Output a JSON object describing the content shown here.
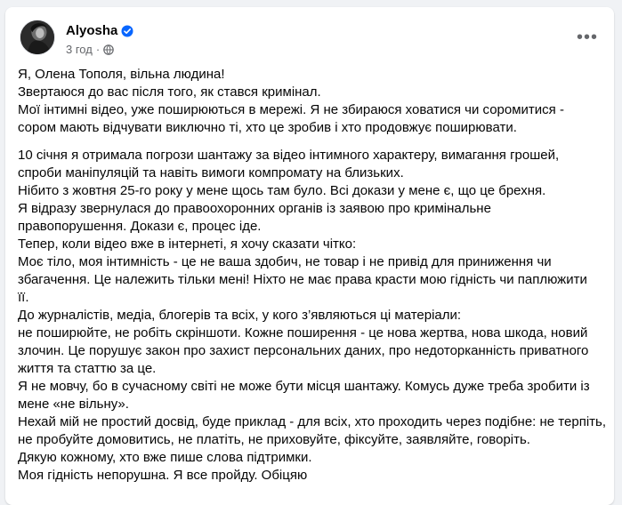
{
  "post": {
    "author": "Alyosha",
    "time": "3 год",
    "meta_separator": "·",
    "more_label": "•••",
    "paragraphs": [
      [
        "Я, Олена Тополя, вільна людина!",
        "Звертаюся до вас після того, як стався кримінал.",
        "Мої інтимні відео, уже поширюються в мережі. Я не збираюся ховатися чи соромитися -",
        "сором мають відчувати виключно ті, хто це зробив і хто продовжує поширювати."
      ],
      [
        "10 січня я отримала погрози шантажу за відео інтимного характеру, вимагання грошей,",
        "спроби маніпуляцій та навіть вимоги компромату на близьких.",
        "Нібито з жовтня 25-го року у мене щось там було. Всі докази у мене є, що це брехня.",
        "Я відразу звернулася до правоохоронних органів із заявою про кримінальне",
        "правопорушення. Докази є, процес іде.",
        "Тепер, коли відео вже в інтернеті, я хочу сказати чітко:",
        "Моє тіло, моя інтимність - це не ваша здобич, не товар і не привід для приниження чи",
        "збагачення. Це належить тільки мені!  Ніхто не має права красти мою гідність чи паплюжити",
        "її.",
        "До журналістів, медіа, блогерів та всіх, у кого з’являються ці матеріали:",
        "не поширюйте, не робіть скріншоти. Кожне поширення - це нова жертва, нова шкода, новий",
        "злочин. Це порушує закон про захист персональних даних, про недоторканність приватного",
        "життя та статтю за це.",
        "Я не мовчу, бо в сучасному світі не може бути місця шантажу. Комусь дуже треба зробити із",
        "мене «не вільну».",
        "Нехай мій не простий досвід, буде приклад - для всіх, хто проходить через подібне: не терпіть,",
        "не пробуйте домовитись, не платіть, не приховуйте, фіксуйте, заявляйте, говоріть.",
        "Дякую кожному, хто вже пише слова підтримки.",
        "Моя гідність непорушна. Я все пройду. Обіцяю"
      ]
    ]
  },
  "icons": {
    "avatar": "profile-photo",
    "verified": "verified-badge-icon",
    "audience": "globe-icon",
    "more": "more-options-icon"
  },
  "colors": {
    "verified_blue": "#0866ff",
    "secondary_text": "#65676b",
    "primary_text": "#050505"
  }
}
